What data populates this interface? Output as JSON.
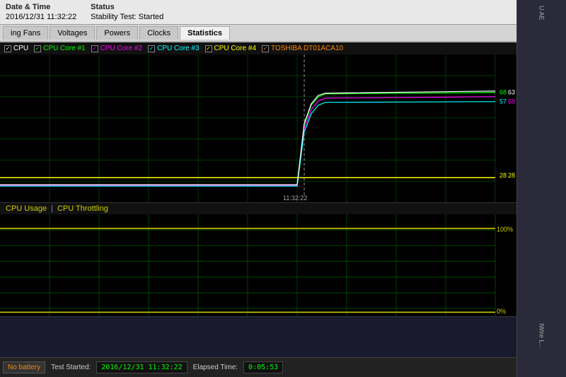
{
  "header": {
    "col1_header": "Date & Time",
    "col2_header": "Status",
    "date_value": "2016/12/31 11:32:22",
    "status_value": "Stability Test: Started"
  },
  "tabs": {
    "items": [
      {
        "label": "ing Fans",
        "active": false
      },
      {
        "label": "Voltages",
        "active": false
      },
      {
        "label": "Powers",
        "active": false
      },
      {
        "label": "Clocks",
        "active": false
      },
      {
        "label": "Statistics",
        "active": true
      }
    ]
  },
  "legend": {
    "items": [
      {
        "label": "CPU",
        "color": "#ffffff",
        "checked": true
      },
      {
        "label": "CPU Core #1",
        "color": "#00ff00",
        "checked": true
      },
      {
        "label": "CPU Core #2",
        "color": "#ff00ff",
        "checked": true
      },
      {
        "label": "CPU Core #3",
        "color": "#00ffff",
        "checked": true
      },
      {
        "label": "CPU Core #4",
        "color": "#ffff00",
        "checked": true
      },
      {
        "label": "TOSHIBA DT01ACA10",
        "color": "#ff8800",
        "checked": true
      }
    ]
  },
  "temp_chart": {
    "timestamp": "11:32:22",
    "values": {
      "val68": "68",
      "val63": "63",
      "val57": "57",
      "val69": "69",
      "val28a": "28",
      "val28b": "28"
    }
  },
  "usage_chart": {
    "title": "CPU Usage",
    "separator": "|",
    "throttling_label": "CPU Throttling",
    "percent_100": "100%",
    "percent_0": "0%"
  },
  "status_bar": {
    "battery": "No battery",
    "test_started_label": "Test Started:",
    "test_started_value": "2016/12/31 11:32:22",
    "elapsed_label": "Elapsed Time:",
    "elapsed_value": "0:05:53"
  },
  "sidebar": {
    "text": "U AE",
    "bottom_text": "IWire L..."
  }
}
